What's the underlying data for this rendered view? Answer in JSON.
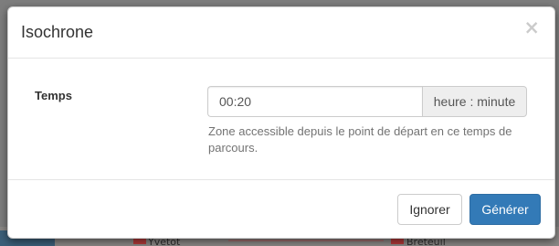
{
  "backdrop": {
    "map_labels": [
      "Yvetot",
      "Breteuil"
    ]
  },
  "modal": {
    "title": "Isochrone",
    "close_symbol": "×",
    "field": {
      "label": "Temps",
      "value": "00:20",
      "addon": "heure : minute",
      "help": "Zone accessible depuis le point de départ en ce temps de parcours."
    },
    "footer": {
      "ignore_label": "Ignorer",
      "generate_label": "Générer"
    }
  },
  "colors": {
    "primary": "#337ab7",
    "backdrop": "#7d7d7d"
  }
}
